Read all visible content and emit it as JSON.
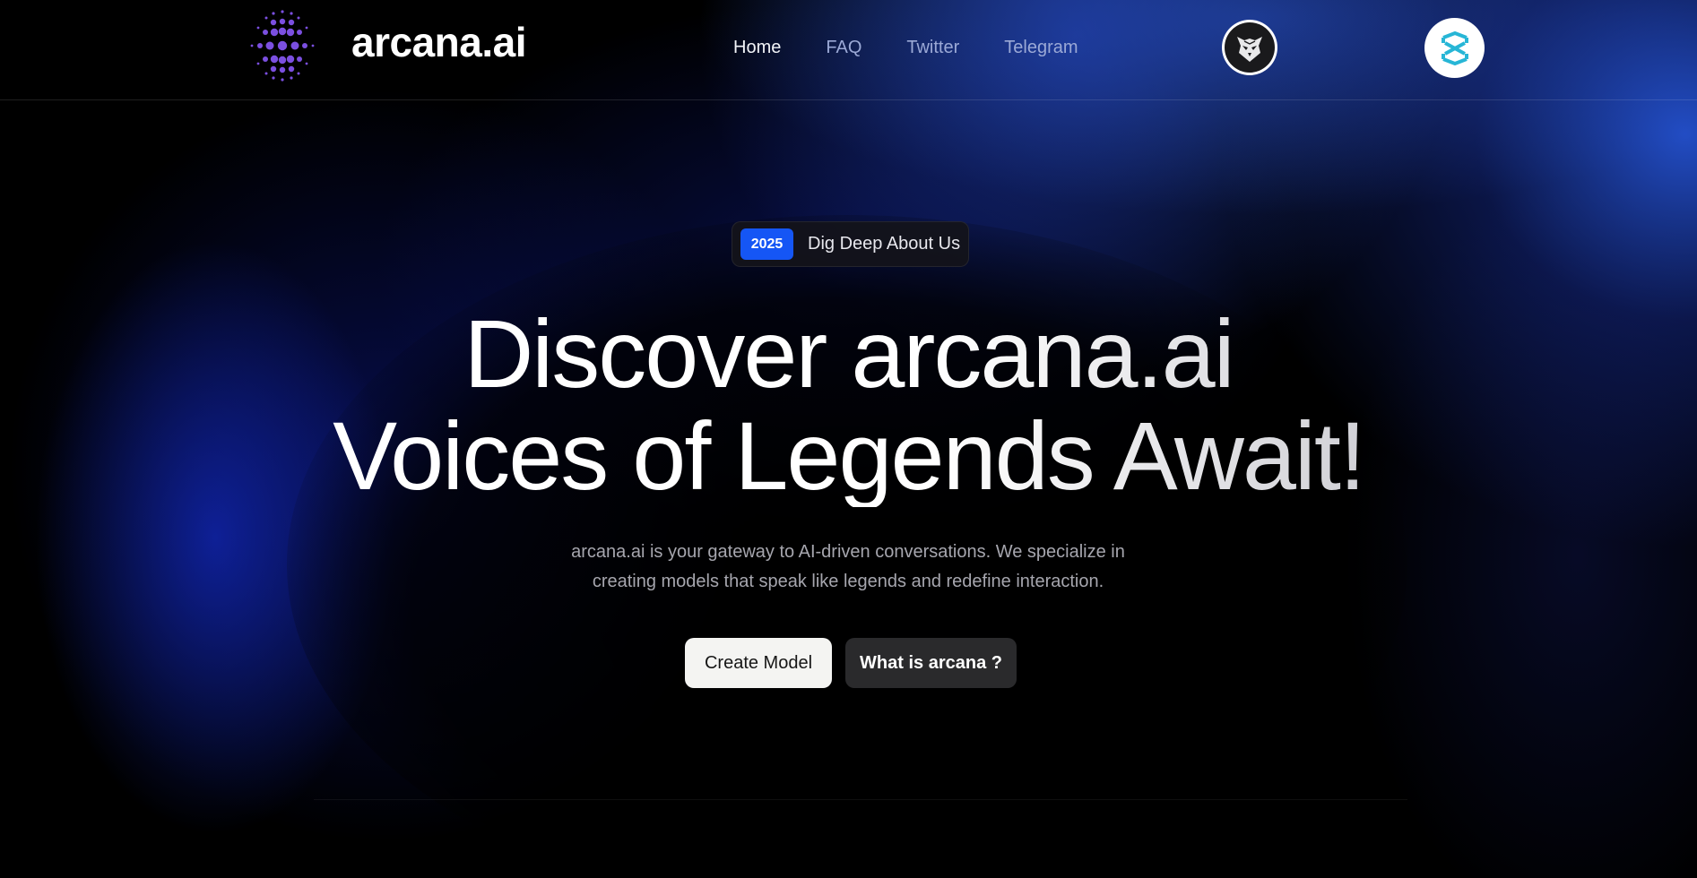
{
  "header": {
    "brand": "arcana.ai",
    "nav": [
      {
        "label": "Home",
        "active": true
      },
      {
        "label": "FAQ",
        "active": false
      },
      {
        "label": "Twitter",
        "active": false
      },
      {
        "label": "Telegram",
        "active": false
      }
    ],
    "icons": [
      "dotted-sphere-logo-icon",
      "owl-avatar-icon",
      "dexscreener-icon"
    ]
  },
  "hero": {
    "badge_year": "2025",
    "badge_text": "Dig Deep About Us",
    "headline_line1": "Discover arcana.ai",
    "headline_line2": "Voices of Legends Await!",
    "subtitle_line1": "arcana.ai is your gateway to AI-driven conversations. We specialize in",
    "subtitle_line2": "creating models that speak like legends and redefine interaction.",
    "primary_button": "Create Model",
    "secondary_button": "What is arcana ?"
  },
  "colors": {
    "accent_blue": "#1556f5",
    "logo_purple": "#7b4fe0",
    "dex_teal": "#27b6d6",
    "background": "#000000"
  }
}
